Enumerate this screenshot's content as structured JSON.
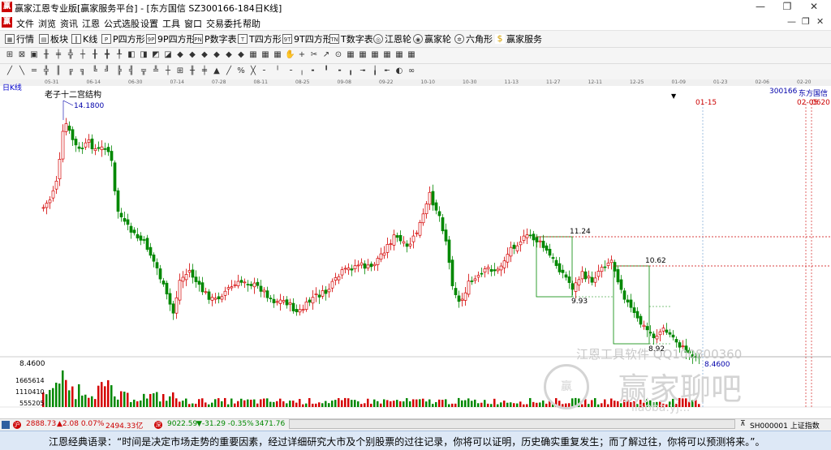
{
  "window": {
    "title": "赢家江恩专业版[赢家服务平台] - [东方国信  SZ300166-184日K线]",
    "buttons": [
      "—",
      "❐",
      "✕"
    ]
  },
  "menubar": {
    "items": [
      "文件",
      "浏览",
      "资讯",
      "江恩",
      "公式选股",
      "设置",
      "工具",
      "窗口",
      "交易委托",
      "帮助"
    ],
    "mdi": [
      "—",
      "❐",
      "✕"
    ]
  },
  "toolbar1": {
    "items": [
      {
        "label": "行情",
        "icon": "grid-icon"
      },
      {
        "label": "板块",
        "icon": "board-icon"
      },
      {
        "label": "K线",
        "icon": "kline-icon"
      },
      {
        "label": "P四方形",
        "icon": "P"
      },
      {
        "label": "9P四方形",
        "icon": "9P"
      },
      {
        "label": "P数字表",
        "icon": "PN"
      },
      {
        "label": "T四方形",
        "icon": "T"
      },
      {
        "label": "9T四方形",
        "icon": "9T"
      },
      {
        "label": "T数字表",
        "icon": "TN"
      },
      {
        "label": "江恩轮",
        "icon": "wheel-icon"
      },
      {
        "label": "赢家轮",
        "icon": "wheel2-icon"
      },
      {
        "label": "六角形",
        "icon": "hexagon-icon"
      },
      {
        "label": "赢家服务",
        "icon": "dollar-icon"
      }
    ]
  },
  "chart": {
    "period_label": "日K线",
    "stock_code": "300166",
    "stock_name": "东方国信",
    "indicator_name": "老子十二宫结构",
    "high_label": "14.1800",
    "low_label": "8.4600",
    "price_axis_label": "8.4600",
    "level_labels": [
      "11.24",
      "10.62",
      "9.93",
      "8.92"
    ],
    "date_marks": [
      "01-15",
      "02-05",
      "0620"
    ],
    "volume_labels": [
      "1665614",
      "1110410",
      "555205"
    ],
    "date_strip": [
      "05-31",
      "06-14",
      "06-30",
      "07-14",
      "07-28",
      "08-11",
      "08-25",
      "09-08",
      "09-22",
      "10-10",
      "10-30",
      "11-13",
      "11-27",
      "12-11",
      "12-25",
      "01-09",
      "01-23",
      "02-06",
      "02-20"
    ]
  },
  "watermark": {
    "line1": "江恩工具软件  QQ100800360",
    "line2": "赢家聊吧",
    "line3": "liaoba.yj..."
  },
  "bottombar": {
    "sh_index": "2888.73",
    "sh_change": "▲2.08 0.07%",
    "sh_amount": "2494.33亿",
    "sz_index": "9022.59",
    "sz_change": "▼-31.29 -0.35%",
    "sz_amount": "3471.76",
    "ticker": "SH000001 上证指数"
  },
  "quote": {
    "text": "江恩经典语录：“时间是决定市场走势的重要因素，经过详细研究大市及个别股票的过往记录，你将可以证明，历史确实重复发生；而了解过往，你将可以预测将来。”。"
  },
  "colors": {
    "up": "#d40000",
    "down": "#008800",
    "accent": "#0033aa",
    "level_line": "#cc0000"
  }
}
